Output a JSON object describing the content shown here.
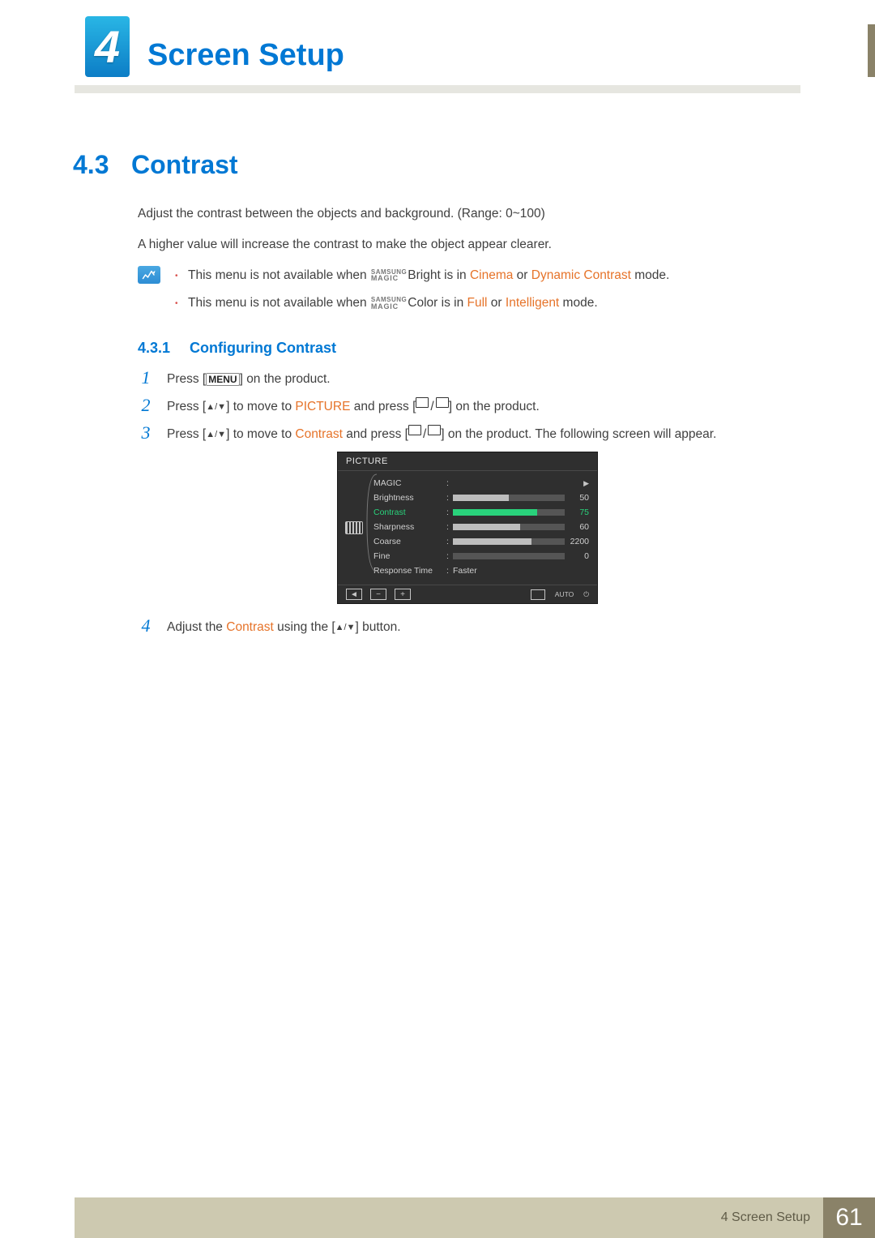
{
  "chapter": {
    "num": "4",
    "title": "Screen Setup"
  },
  "side_stub": true,
  "section": {
    "num": "4.3",
    "title": "Contrast"
  },
  "intro": {
    "p1": "Adjust the contrast between the objects and background. (Range: 0~100)",
    "p2": "A higher value will increase the contrast to make the object appear clearer."
  },
  "magic": {
    "top": "SAMSUNG",
    "bottom": "MAGIC"
  },
  "notes": [
    {
      "pre": "This menu is not available when ",
      "suffix": "Bright",
      "mid": " is in ",
      "o1": "Cinema",
      "or": " or ",
      "o2": "Dynamic Contrast",
      "end": " mode."
    },
    {
      "pre": "This menu is not available when ",
      "suffix": "Color",
      "mid": " is in ",
      "o1": "Full",
      "or": " or ",
      "o2": "Intelligent",
      "end": " mode."
    }
  ],
  "subsection": {
    "num": "4.3.1",
    "title": "Configuring Contrast"
  },
  "steps": [
    {
      "n": "1",
      "pre": "Press [",
      "key": "MENU",
      "post": "] on the product."
    },
    {
      "n": "2",
      "pre": "Press [",
      "arrows": "▲/▼",
      "mid": "] to move to ",
      "o": "PICTURE",
      "post2": " and press [",
      "enter": true,
      "end": "] on the product."
    },
    {
      "n": "3",
      "pre": "Press [",
      "arrows": "▲/▼",
      "mid": "] to move to ",
      "o": "Contrast",
      "post2": " and press [",
      "enter": true,
      "end": "] on the product. The following screen will appear."
    },
    {
      "n": "4",
      "pre": "Adjust the ",
      "o": "Contrast",
      "post2": " using the [",
      "arrows": "▲/▼",
      "end": "] button."
    }
  ],
  "osd": {
    "title": "PICTURE",
    "rows": [
      {
        "label": "MAGIC",
        "type": "arrow",
        "tri": "▶"
      },
      {
        "label": "Brightness",
        "type": "bar",
        "pct": 50,
        "val": "50"
      },
      {
        "label": "Contrast",
        "type": "bar",
        "pct": 75,
        "val": "75",
        "sel": true
      },
      {
        "label": "Sharpness",
        "type": "bar",
        "pct": 60,
        "val": "60"
      },
      {
        "label": "Coarse",
        "type": "bar",
        "pct": 70,
        "val": "2200"
      },
      {
        "label": "Fine",
        "type": "bar",
        "pct": 0,
        "val": "0"
      },
      {
        "label": "Response Time",
        "type": "text",
        "text": "Faster"
      }
    ],
    "foot_left": [
      "◄",
      "−",
      "+"
    ],
    "foot_right_auto": "AUTO"
  },
  "footer": {
    "text": "4 Screen Setup",
    "page": "61"
  }
}
